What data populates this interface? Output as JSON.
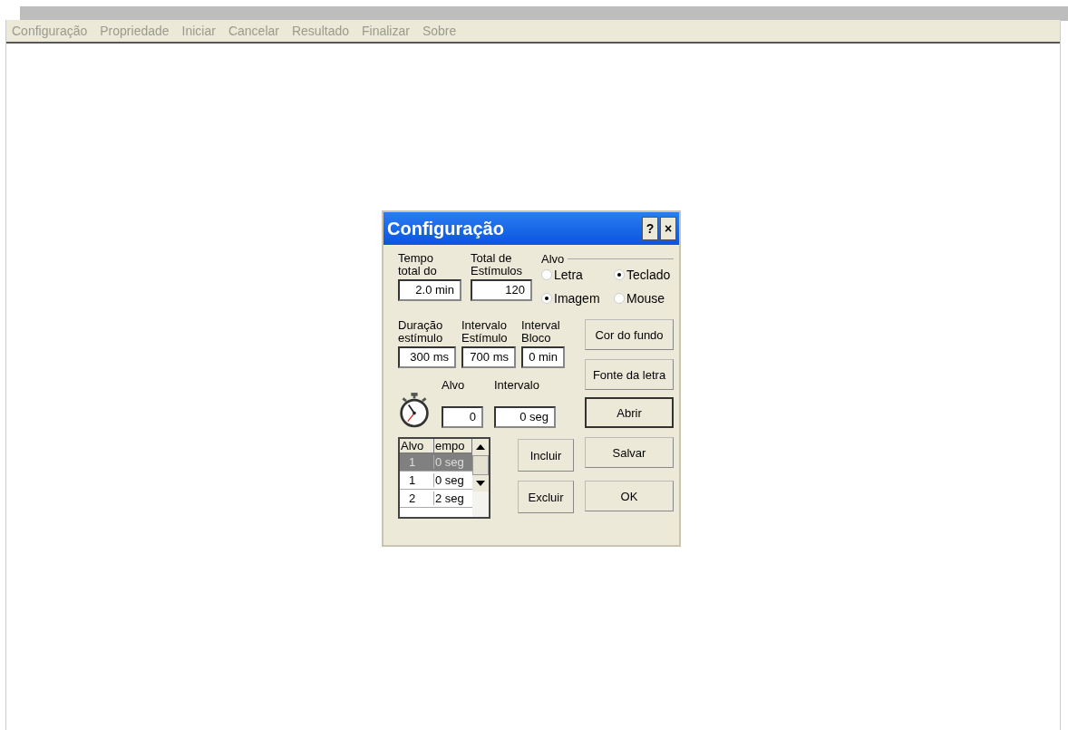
{
  "menu": [
    "Configuração",
    "Propriedade",
    "Iniciar",
    "Cancelar",
    "Resultado",
    "Finalizar",
    "Sobre"
  ],
  "dialog": {
    "title": "Configuração",
    "help": "?",
    "close": "×",
    "top_fields": [
      {
        "label": "Tempo\ntotal do",
        "value": "2.0 min"
      },
      {
        "label": "Total de\nEstímulos",
        "value": "120"
      }
    ],
    "alvo_group": {
      "label": "Alvo",
      "options": [
        {
          "label": "Letra",
          "selected": false
        },
        {
          "label": "Teclado",
          "selected": true
        },
        {
          "label": "Imagem",
          "selected": true
        },
        {
          "label": "Mouse",
          "selected": false
        }
      ]
    },
    "mid_fields": [
      {
        "label": "Duração\nestímulo",
        "value": "300 ms"
      },
      {
        "label": "Intervalo\nEstímulo",
        "value": "700 ms"
      },
      {
        "label": "Interval\nBloco",
        "value": "0 min"
      }
    ],
    "timer_fields": [
      {
        "label": "Alvo",
        "value": "0"
      },
      {
        "label": "Intervalo",
        "value": "0 seg"
      }
    ],
    "table": {
      "columns": [
        "Alvo",
        "empo"
      ],
      "rows": [
        {
          "cells": [
            "1",
            "0 seg"
          ],
          "selected": true
        },
        {
          "cells": [
            "1",
            "0 seg"
          ],
          "selected": false
        },
        {
          "cells": [
            "2",
            "2 seg"
          ],
          "selected": false
        }
      ]
    },
    "buttons": {
      "cor": {
        "label": "Cor do fundo",
        "default": false
      },
      "fonte": {
        "label": "Fonte da letra",
        "default": false
      },
      "abrir": {
        "label": "Abrir",
        "default": true
      },
      "incluir": {
        "label": "Incluir",
        "default": false
      },
      "salvar": {
        "label": "Salvar",
        "default": false
      },
      "excluir": {
        "label": "Excluir",
        "default": false
      },
      "ok": {
        "label": "OK",
        "default": false
      }
    }
  }
}
